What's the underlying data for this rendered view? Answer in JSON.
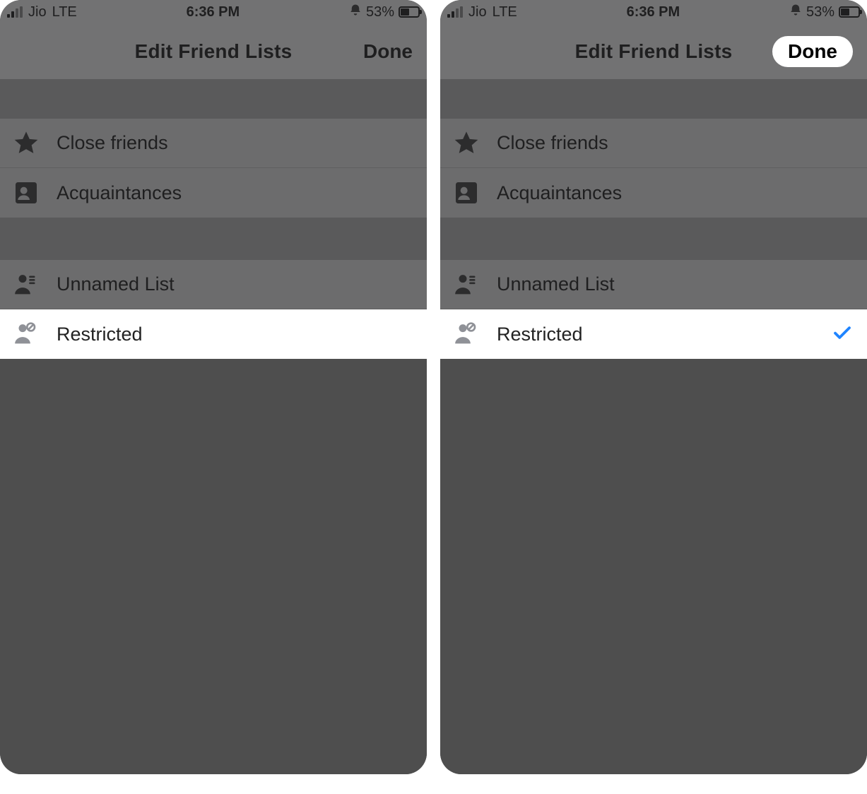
{
  "status": {
    "carrier": "Jio",
    "network": "LTE",
    "time": "6:36 PM",
    "battery_pct": "53%"
  },
  "nav": {
    "title": "Edit Friend Lists",
    "done": "Done"
  },
  "lists": {
    "close_friends": "Close friends",
    "acquaintances": "Acquaintances",
    "unnamed": "Unnamed List",
    "restricted": "Restricted"
  },
  "screens": {
    "left": {
      "restricted_checked": false,
      "done_highlighted": false
    },
    "right": {
      "restricted_checked": true,
      "done_highlighted": true
    }
  }
}
